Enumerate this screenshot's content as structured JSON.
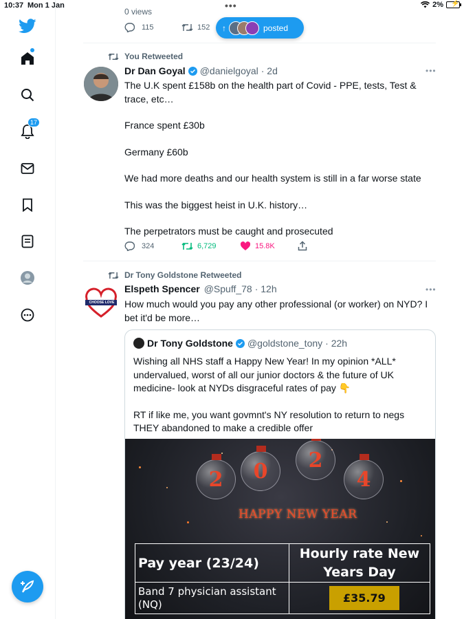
{
  "status_bar": {
    "time": "10:37",
    "date": "Mon 1 Jan",
    "battery": "2%"
  },
  "sidebar": {
    "notifications_badge": "17",
    "icons": [
      "twitter-logo-icon",
      "home-icon",
      "search-icon",
      "bell-icon",
      "mail-icon",
      "bookmark-icon",
      "lists-icon",
      "profile-icon",
      "more-icon",
      "compose-icon"
    ]
  },
  "top_tweet": {
    "views": "0 views",
    "replies": "115",
    "retweets": "152"
  },
  "posted_pill": {
    "label": "posted"
  },
  "tweet1": {
    "retweeted_by": "You Retweeted",
    "name": "Dr Dan Goyal",
    "handle": "@danielgoyal",
    "time": "· 2d",
    "paragraphs": [
      "The U.K spent £158b on the health part of Covid - PPE, tests, Test & trace, etc…",
      "France spent £30b",
      "Germany £60b",
      "We had more deaths and our health system is still in a far worse state",
      "This was the biggest heist in U.K. history…",
      "The perpetrators must be caught and prosecuted"
    ],
    "replies": "324",
    "retweets": "6,729",
    "likes": "15.8K"
  },
  "tweet2": {
    "retweeted_by": "Dr Tony Goldstone Retweeted",
    "avatar_text": "CHOOSE LOVE",
    "name": "Elspeth Spencer",
    "handle": "@Spuff_78",
    "time": "· 12h",
    "text": "How much would you pay any other professional (or worker) on NYD? I bet it'd be more…",
    "quote": {
      "name": "Dr Tony Goldstone",
      "handle": "@goldstone_tony",
      "time": "· 22h",
      "paragraph1": "Wishing all NHS staff a Happy New Year! In my opinion *ALL* undervalued, worst of all our junior doctors & the future of UK medicine- look at NYDs disgraceful rates of pay 👇",
      "paragraph2": "RT if like me, you want govmnt's NY resolution to return to negs THEY abandoned to make a credible offer",
      "image": {
        "ornaments": [
          "2",
          "0",
          "2",
          "4"
        ],
        "greeting": "HAPPY NEW YEAR",
        "table_header_left": "Pay year (23/24)",
        "table_header_right": "Hourly rate New Years Day",
        "row_label": "Band 7 physician assistant (NQ)",
        "row_rate": "£35.79"
      }
    }
  },
  "colors": {
    "accent": "#1d9bf0",
    "retweet_green": "#00ba7c",
    "like_pink": "#f91880",
    "muted": "#536471"
  }
}
